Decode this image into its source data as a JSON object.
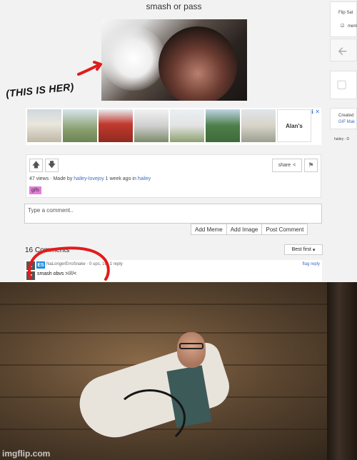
{
  "post": {
    "title": "smash or pass",
    "annotation": "(THIS IS HER)",
    "views": "47 views",
    "made_by_prefix": "Made by",
    "author": "hailey-lovejoy",
    "time_ago": "1 week ago in",
    "stream": "hailey",
    "tag": "gifs",
    "share_label": "share"
  },
  "ad": {
    "logo_text": "Alan's",
    "marker": "ℹ ✕"
  },
  "comment_form": {
    "placeholder": "Type a comment..",
    "buttons": [
      "Add Meme",
      "Add Image",
      "Post Comment"
    ]
  },
  "comments": {
    "count_label": "16 Comments",
    "sort_label": "Best first",
    "items": [
      {
        "avatar_text": "ES",
        "username": "NaLongerErroSnake",
        "meta": "0 ups, 1w, 1 reply",
        "text": "smash obvs >////<",
        "flag_reply": "flag reply"
      }
    ]
  },
  "sidebar": {
    "label_top": "Flip Sat",
    "checkbox_label": "mem",
    "box2_text1": "Created",
    "box2_text2": "GIF Mak",
    "footer": "hailey - D"
  },
  "watermark": "imgflip.com",
  "colors": {
    "annotation_red": "#e21b1b",
    "tag_pink": "#e37cd9",
    "link_blue": "#3a6ec4"
  }
}
